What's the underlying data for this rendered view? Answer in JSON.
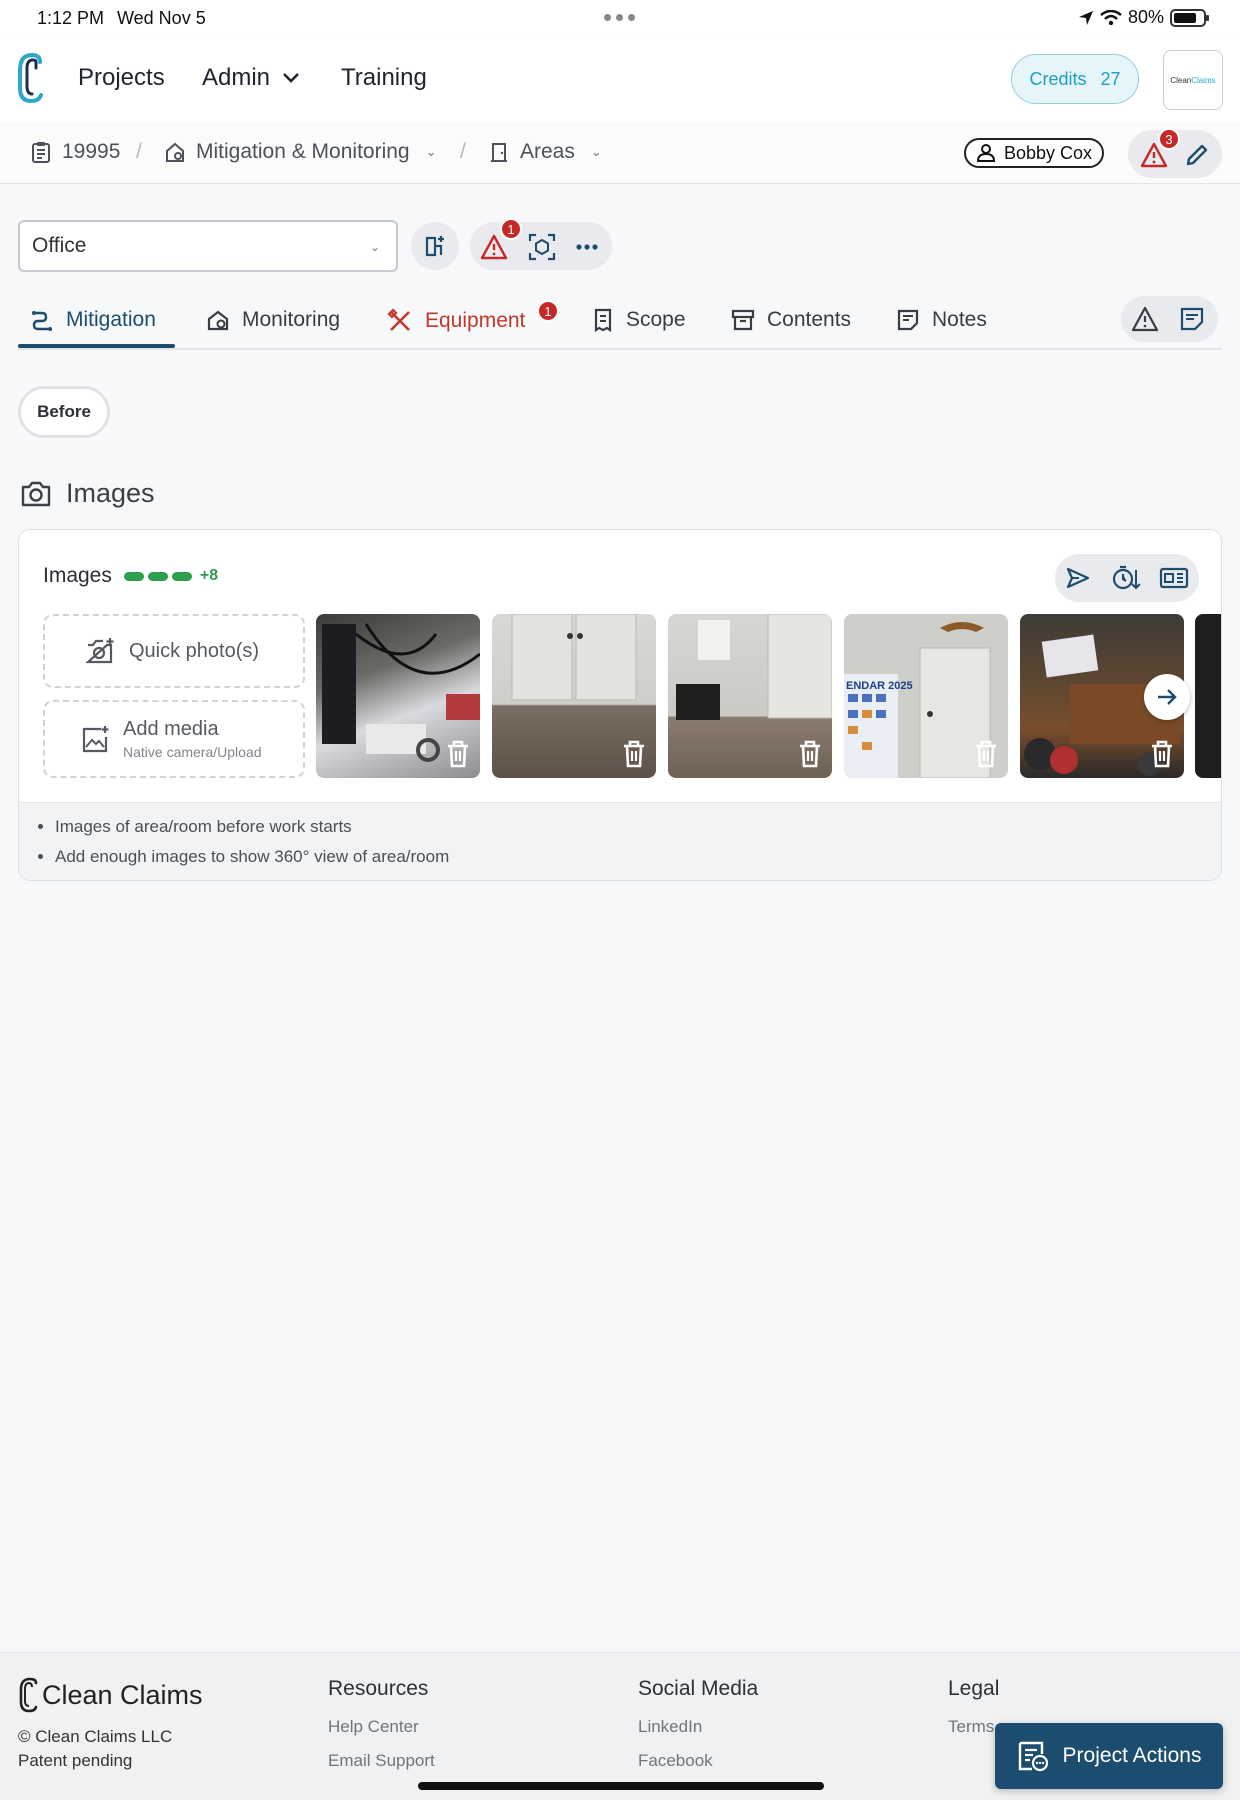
{
  "status_bar": {
    "time": "1:12 PM",
    "date": "Wed Nov 5",
    "battery": "80%"
  },
  "nav": {
    "projects": "Projects",
    "admin": "Admin",
    "training": "Training",
    "credits_label": "Credits",
    "credits_value": "27",
    "avatar_text_1": "Clean",
    "avatar_text_2": "Claims"
  },
  "breadcrumb": {
    "project_id": "19995",
    "stage": "Mitigation & Monitoring",
    "section": "Areas",
    "user": "Bobby Cox",
    "alert_count": "3"
  },
  "area": {
    "selected": "Office",
    "alert_count": "1"
  },
  "tabs": [
    {
      "label": "Mitigation",
      "active": true
    },
    {
      "label": "Monitoring"
    },
    {
      "label": "Equipment",
      "badge": "1",
      "color": "#c0392b"
    },
    {
      "label": "Scope"
    },
    {
      "label": "Contents"
    },
    {
      "label": "Notes"
    }
  ],
  "phase_chip": "Before",
  "images_section": {
    "title": "Images",
    "card_title": "Images",
    "progress_extra": "+8",
    "quick_photo": "Quick photo(s)",
    "add_media": "Add media",
    "add_media_sub": "Native camera/Upload",
    "hints": [
      "Images of area/room before work starts",
      "Add enough images to show 360° view of area/room"
    ],
    "calendar_text": "ENDAR 2025"
  },
  "footer": {
    "brand": "Clean Claims",
    "copyright": "© Clean Claims LLC",
    "patent": "Patent pending",
    "resources_title": "Resources",
    "resources": [
      "Help Center",
      "Email Support"
    ],
    "social_title": "Social Media",
    "social": [
      "LinkedIn",
      "Facebook"
    ],
    "legal_title": "Legal",
    "legal": [
      "Terms"
    ],
    "project_actions": "Project Actions"
  },
  "colors": {
    "accent": "#1c4d6e",
    "credits": "#1e9fc0",
    "alert": "#c62828",
    "success": "#2e9e4f"
  }
}
